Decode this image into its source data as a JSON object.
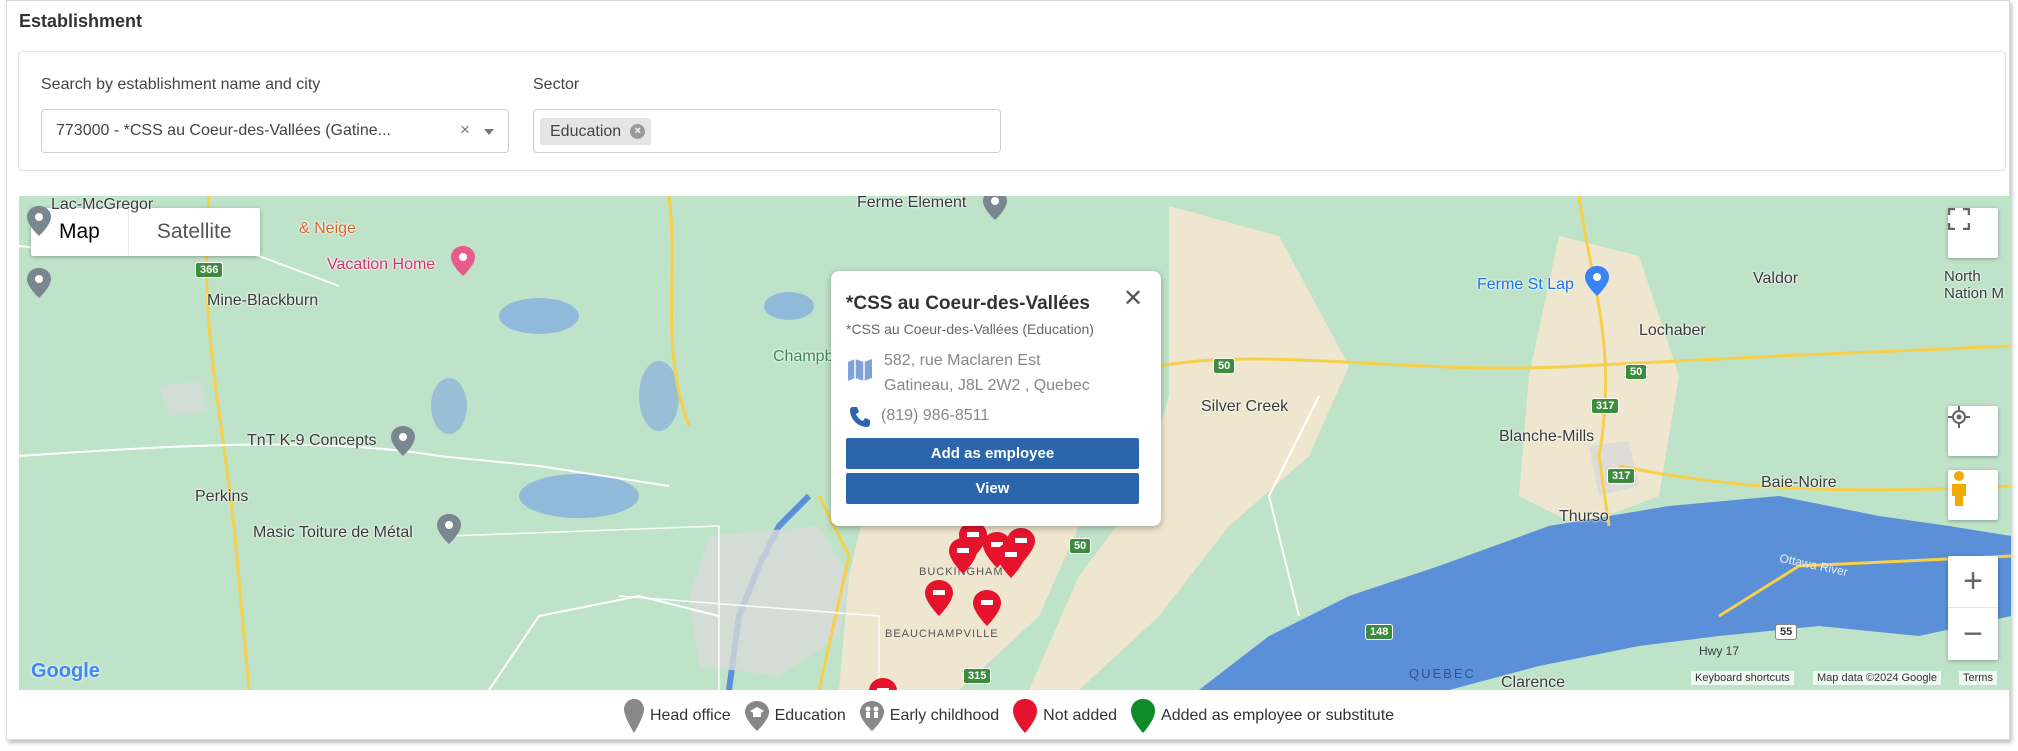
{
  "section": {
    "title": "Establishment"
  },
  "filters": {
    "search_label": "Search by establishment name and city",
    "search_value": "773000 - *CSS au Coeur-des-Vallées (Gatine...",
    "clear_symbol": "×",
    "sector_label": "Sector",
    "sector_chip": "Education"
  },
  "map": {
    "type_buttons": {
      "map": "Map",
      "satellite": "Satellite"
    },
    "places": {
      "lac_mcgregor": "Lac-McGregor",
      "neige": "& Neige",
      "vacation_home": "Vacation Home",
      "mine_blackburn": "Mine-Blackburn",
      "tnt": "TnT K-9 Concepts",
      "perkins": "Perkins",
      "masic": "Masic Toiture de Métal",
      "ferme_element": "Ferme Element",
      "champ": "Champb",
      "silver_creek": "Silver Creek",
      "ferme_st_lap": "Ferme St Lap",
      "valdor": "Valdor",
      "north_nation": "North Nation M",
      "lochaber": "Lochaber",
      "blanche_mills": "Blanche-Mills",
      "baie_noire": "Baie-Noire",
      "thurso": "Thurso",
      "clarence": "Clarence",
      "buckingham": "BUCKINGHAM",
      "beauchampville": "BEAUCHAMPVILLE",
      "ottawa_river": "Ottawa River",
      "quebec": "QUEBEC",
      "hwy17": "Hwy 17"
    },
    "routes": {
      "r366": "366",
      "r50a": "50",
      "r50b": "50",
      "r50c": "50",
      "r317a": "317",
      "r317b": "317",
      "r148": "148",
      "r55": "55",
      "r315": "315"
    },
    "footer": {
      "google": "Google",
      "keyboard": "Keyboard shortcuts",
      "mapdata": "Map data ©2024 Google",
      "terms": "Terms"
    },
    "colors": {
      "land": "#bfe3c8",
      "water": "#5b8fd8",
      "farm": "#efe6cf",
      "road": "#f6cf4b",
      "pin_red": "#e5142c",
      "pin_green": "#0e8a2a",
      "pin_gray": "#888888"
    }
  },
  "popup": {
    "title": "*CSS au Coeur-des-Vallées",
    "subtitle": "*CSS au Coeur-des-Vallées (Education)",
    "address_line1": "582, rue Maclaren Est",
    "address_line2": "Gatineau, J8L 2W2 , Quebec",
    "phone": "(819) 986-8511",
    "add_button": "Add as employee",
    "view_button": "View"
  },
  "legend": {
    "head_office": "Head office",
    "education": "Education",
    "early_childhood": "Early childhood",
    "not_added": "Not added",
    "added": "Added as employee or substitute"
  }
}
